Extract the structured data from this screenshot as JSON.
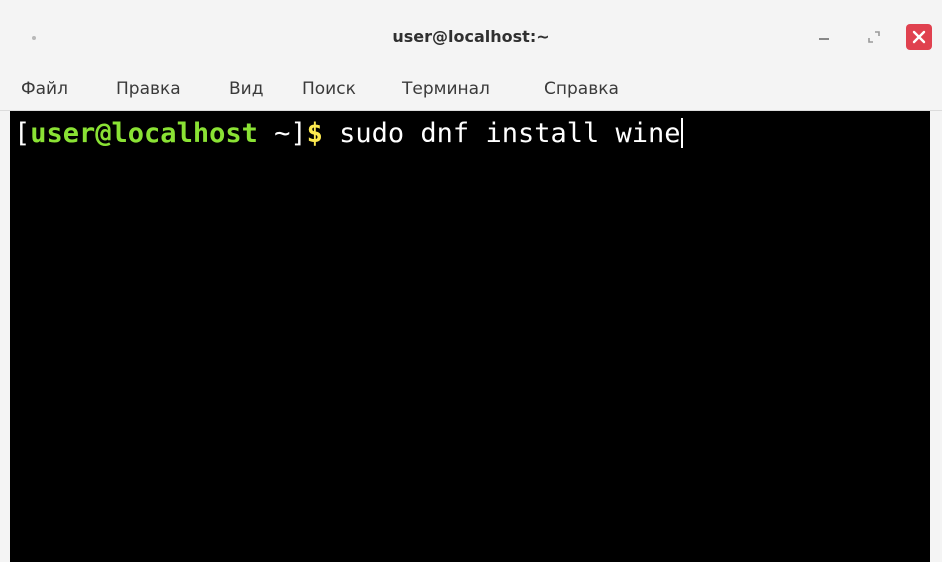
{
  "window": {
    "title": "user@localhost:~"
  },
  "menu": {
    "items": [
      {
        "label": "Файл"
      },
      {
        "label": "Правка"
      },
      {
        "label": "Вид"
      },
      {
        "label": "Поиск"
      },
      {
        "label": "Терминал"
      },
      {
        "label": "Справка"
      }
    ]
  },
  "terminal": {
    "prompt_open": "[",
    "prompt_userhost": "user@localhost",
    "prompt_cwd": " ~]",
    "prompt_symbol": "$",
    "command": " sudo dnf install wine"
  },
  "icons": {
    "window_menu": "dot-icon",
    "minimize": "minimize-icon",
    "maximize": "maximize-icon",
    "close": "close-icon"
  },
  "colors": {
    "terminal_bg": "#000000",
    "prompt_userhost": "#8ae234",
    "prompt_symbol": "#fce94f",
    "close_button": "#e0414f"
  }
}
